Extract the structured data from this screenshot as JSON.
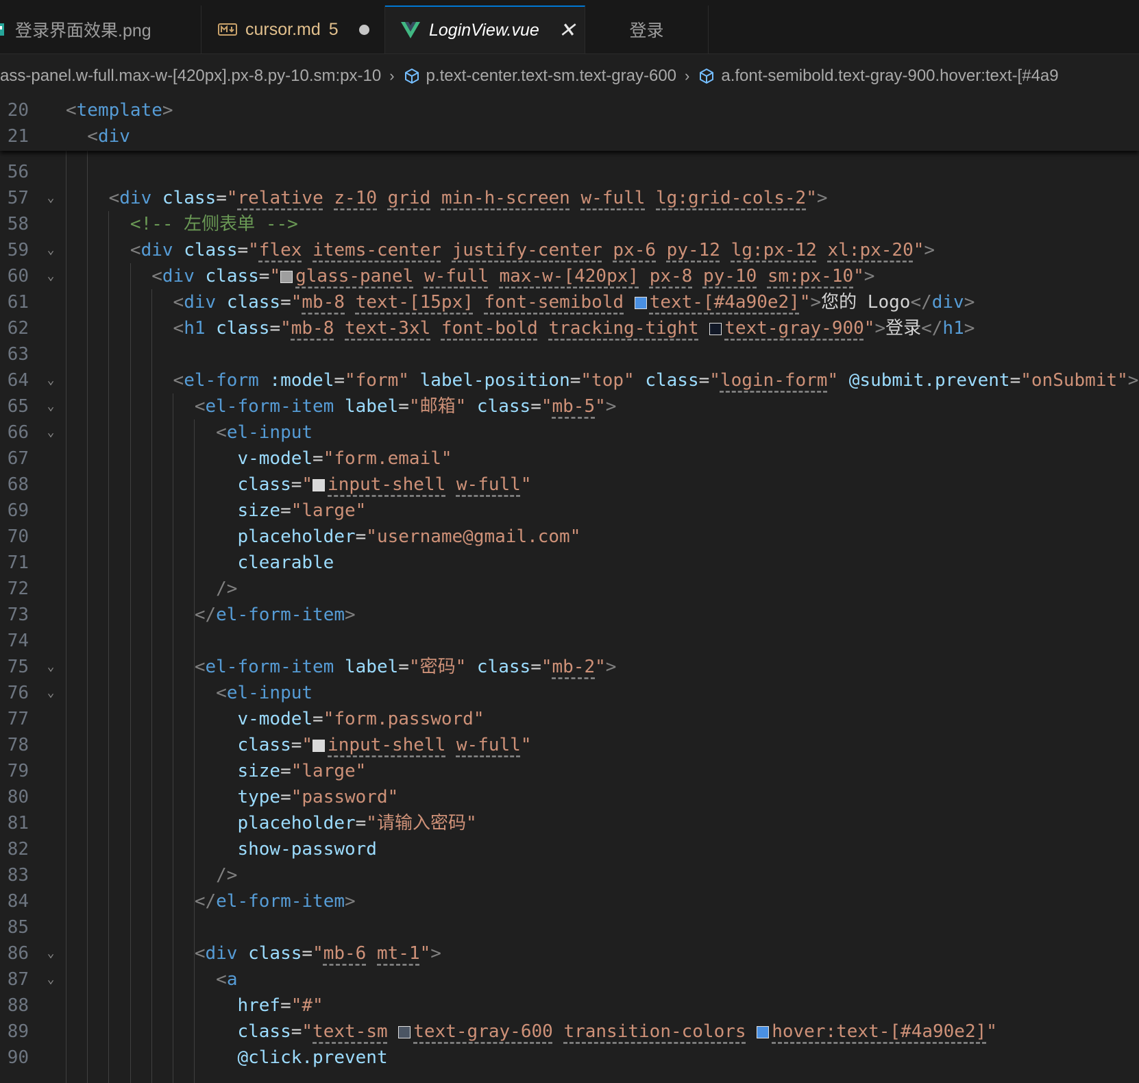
{
  "tabs": [
    {
      "label": "登录界面效果.png"
    },
    {
      "label": "cursor.md",
      "badge": "5"
    },
    {
      "label": "LoginView.vue"
    },
    {
      "label": "登录"
    }
  ],
  "breadcrumb": [
    "ass-panel.w-full.max-w-[420px].px-8.py-10.sm:px-10",
    "p.text-center.text-sm.text-gray-600",
    "a.font-semibold.text-gray-900.hover:text-[#4a9"
  ],
  "swatches": {
    "glass_panel": "#9e9e9e",
    "text_blue": "#4a90e2",
    "text_gray_900": "#111827",
    "input_shell": "#d9d9d9",
    "text_gray_600": "#4b5563"
  },
  "sticky_lines": [
    {
      "num": "20",
      "code": [
        {
          "c": "t",
          "v": "<"
        },
        {
          "c": "tg",
          "v": "template"
        },
        {
          "c": "t",
          "v": ">"
        }
      ]
    },
    {
      "num": "21",
      "code": [
        {
          "c": "t",
          "v": "  <"
        },
        {
          "c": "tg",
          "v": "div"
        }
      ]
    }
  ],
  "lines": [
    {
      "num": "56",
      "fold": false,
      "code": []
    },
    {
      "num": "57",
      "fold": true,
      "code": [
        {
          "c": "t",
          "v": "    <"
        },
        {
          "c": "tg",
          "v": "div"
        },
        {
          "c": "tx",
          "v": " "
        },
        {
          "c": "at",
          "v": "class"
        },
        {
          "c": "tx",
          "v": "="
        },
        {
          "c": "s",
          "v": "\""
        },
        {
          "c": "s cls",
          "v": "relative"
        },
        {
          "c": "s",
          "v": " "
        },
        {
          "c": "s cls",
          "v": "z-10"
        },
        {
          "c": "s",
          "v": " "
        },
        {
          "c": "s cls",
          "v": "grid"
        },
        {
          "c": "s",
          "v": " "
        },
        {
          "c": "s cls",
          "v": "min-h-screen"
        },
        {
          "c": "s",
          "v": " "
        },
        {
          "c": "s cls",
          "v": "w-full"
        },
        {
          "c": "s",
          "v": " "
        },
        {
          "c": "s cls",
          "v": "lg:grid-cols-2"
        },
        {
          "c": "s",
          "v": "\""
        },
        {
          "c": "t",
          "v": ">"
        }
      ]
    },
    {
      "num": "58",
      "fold": false,
      "code": [
        {
          "c": "cm",
          "v": "      <!-- 左侧表单 -->"
        }
      ]
    },
    {
      "num": "59",
      "fold": true,
      "code": [
        {
          "c": "t",
          "v": "      <"
        },
        {
          "c": "tg",
          "v": "div"
        },
        {
          "c": "tx",
          "v": " "
        },
        {
          "c": "at",
          "v": "class"
        },
        {
          "c": "tx",
          "v": "="
        },
        {
          "c": "s",
          "v": "\""
        },
        {
          "c": "s cls",
          "v": "flex"
        },
        {
          "c": "s",
          "v": " "
        },
        {
          "c": "s cls",
          "v": "items-center"
        },
        {
          "c": "s",
          "v": " "
        },
        {
          "c": "s cls",
          "v": "justify-center"
        },
        {
          "c": "s",
          "v": " "
        },
        {
          "c": "s cls",
          "v": "px-6"
        },
        {
          "c": "s",
          "v": " "
        },
        {
          "c": "s cls",
          "v": "py-12"
        },
        {
          "c": "s",
          "v": " "
        },
        {
          "c": "s cls",
          "v": "lg:px-12"
        },
        {
          "c": "s",
          "v": " "
        },
        {
          "c": "s cls",
          "v": "xl:px-20"
        },
        {
          "c": "s",
          "v": "\""
        },
        {
          "c": "t",
          "v": ">"
        }
      ]
    },
    {
      "num": "60",
      "fold": true,
      "code": [
        {
          "c": "t",
          "v": "        <"
        },
        {
          "c": "tg",
          "v": "div"
        },
        {
          "c": "tx",
          "v": " "
        },
        {
          "c": "at",
          "v": "class"
        },
        {
          "c": "tx",
          "v": "="
        },
        {
          "c": "s",
          "v": "\""
        },
        {
          "sw": "glass_panel"
        },
        {
          "c": "s cls",
          "v": "glass-panel"
        },
        {
          "c": "s",
          "v": " "
        },
        {
          "c": "s cls",
          "v": "w-full"
        },
        {
          "c": "s",
          "v": " "
        },
        {
          "c": "s cls",
          "v": "max-w-[420px]"
        },
        {
          "c": "s",
          "v": " "
        },
        {
          "c": "s cls",
          "v": "px-8"
        },
        {
          "c": "s",
          "v": " "
        },
        {
          "c": "s cls",
          "v": "py-10"
        },
        {
          "c": "s",
          "v": " "
        },
        {
          "c": "s cls",
          "v": "sm:px-10"
        },
        {
          "c": "s",
          "v": "\""
        },
        {
          "c": "t",
          "v": ">"
        }
      ]
    },
    {
      "num": "61",
      "fold": false,
      "code": [
        {
          "c": "t",
          "v": "          <"
        },
        {
          "c": "tg",
          "v": "div"
        },
        {
          "c": "tx",
          "v": " "
        },
        {
          "c": "at",
          "v": "class"
        },
        {
          "c": "tx",
          "v": "="
        },
        {
          "c": "s",
          "v": "\""
        },
        {
          "c": "s cls",
          "v": "mb-8"
        },
        {
          "c": "s",
          "v": " "
        },
        {
          "c": "s cls",
          "v": "text-[15px]"
        },
        {
          "c": "s",
          "v": " "
        },
        {
          "c": "s cls",
          "v": "font-semibold"
        },
        {
          "c": "s",
          "v": " "
        },
        {
          "sw": "text_blue"
        },
        {
          "c": "s cls",
          "v": "text-[#4a90e2]"
        },
        {
          "c": "s",
          "v": "\""
        },
        {
          "c": "t",
          "v": ">"
        },
        {
          "c": "tx",
          "v": "您的 Logo"
        },
        {
          "c": "t",
          "v": "</"
        },
        {
          "c": "tg",
          "v": "div"
        },
        {
          "c": "t",
          "v": ">"
        }
      ]
    },
    {
      "num": "62",
      "fold": false,
      "code": [
        {
          "c": "t",
          "v": "          <"
        },
        {
          "c": "tg",
          "v": "h1"
        },
        {
          "c": "tx",
          "v": " "
        },
        {
          "c": "at",
          "v": "class"
        },
        {
          "c": "tx",
          "v": "="
        },
        {
          "c": "s",
          "v": "\""
        },
        {
          "c": "s cls",
          "v": "mb-8"
        },
        {
          "c": "s",
          "v": " "
        },
        {
          "c": "s cls",
          "v": "text-3xl"
        },
        {
          "c": "s",
          "v": " "
        },
        {
          "c": "s cls",
          "v": "font-bold"
        },
        {
          "c": "s",
          "v": " "
        },
        {
          "c": "s cls",
          "v": "tracking-tight"
        },
        {
          "c": "s",
          "v": " "
        },
        {
          "sw": "text_gray_900"
        },
        {
          "c": "s cls",
          "v": "text-gray-900"
        },
        {
          "c": "s",
          "v": "\""
        },
        {
          "c": "t",
          "v": ">"
        },
        {
          "c": "tx",
          "v": "登录"
        },
        {
          "c": "t",
          "v": "</"
        },
        {
          "c": "tg",
          "v": "h1"
        },
        {
          "c": "t",
          "v": ">"
        }
      ]
    },
    {
      "num": "63",
      "fold": false,
      "code": []
    },
    {
      "num": "64",
      "fold": true,
      "code": [
        {
          "c": "t",
          "v": "          <"
        },
        {
          "c": "tg",
          "v": "el-form"
        },
        {
          "c": "tx",
          "v": " "
        },
        {
          "c": "at",
          "v": ":model"
        },
        {
          "c": "tx",
          "v": "="
        },
        {
          "c": "s",
          "v": "\"form\""
        },
        {
          "c": "tx",
          "v": " "
        },
        {
          "c": "at",
          "v": "label-position"
        },
        {
          "c": "tx",
          "v": "="
        },
        {
          "c": "s",
          "v": "\"top\""
        },
        {
          "c": "tx",
          "v": " "
        },
        {
          "c": "at",
          "v": "class"
        },
        {
          "c": "tx",
          "v": "="
        },
        {
          "c": "s",
          "v": "\""
        },
        {
          "c": "s cls",
          "v": "login-form"
        },
        {
          "c": "s",
          "v": "\""
        },
        {
          "c": "tx",
          "v": " "
        },
        {
          "c": "at",
          "v": "@submit.prevent"
        },
        {
          "c": "tx",
          "v": "="
        },
        {
          "c": "s",
          "v": "\"onSubmit\""
        },
        {
          "c": "t",
          "v": ">"
        }
      ]
    },
    {
      "num": "65",
      "fold": true,
      "code": [
        {
          "c": "t",
          "v": "            <"
        },
        {
          "c": "tg",
          "v": "el-form-item"
        },
        {
          "c": "tx",
          "v": " "
        },
        {
          "c": "at",
          "v": "label"
        },
        {
          "c": "tx",
          "v": "="
        },
        {
          "c": "s",
          "v": "\"邮箱\""
        },
        {
          "c": "tx",
          "v": " "
        },
        {
          "c": "at",
          "v": "class"
        },
        {
          "c": "tx",
          "v": "="
        },
        {
          "c": "s",
          "v": "\""
        },
        {
          "c": "s cls",
          "v": "mb-5"
        },
        {
          "c": "s",
          "v": "\""
        },
        {
          "c": "t",
          "v": ">"
        }
      ]
    },
    {
      "num": "66",
      "fold": true,
      "code": [
        {
          "c": "t",
          "v": "              <"
        },
        {
          "c": "tg",
          "v": "el-input"
        }
      ]
    },
    {
      "num": "67",
      "fold": false,
      "code": [
        {
          "c": "tx",
          "v": "                "
        },
        {
          "c": "at",
          "v": "v-model"
        },
        {
          "c": "tx",
          "v": "="
        },
        {
          "c": "s",
          "v": "\"form.email\""
        }
      ]
    },
    {
      "num": "68",
      "fold": false,
      "code": [
        {
          "c": "tx",
          "v": "                "
        },
        {
          "c": "at",
          "v": "class"
        },
        {
          "c": "tx",
          "v": "="
        },
        {
          "c": "s",
          "v": "\""
        },
        {
          "sw": "input_shell"
        },
        {
          "c": "s cls",
          "v": "input-shell"
        },
        {
          "c": "s",
          "v": " "
        },
        {
          "c": "s cls",
          "v": "w-full"
        },
        {
          "c": "s",
          "v": "\""
        }
      ]
    },
    {
      "num": "69",
      "fold": false,
      "code": [
        {
          "c": "tx",
          "v": "                "
        },
        {
          "c": "at",
          "v": "size"
        },
        {
          "c": "tx",
          "v": "="
        },
        {
          "c": "s",
          "v": "\"large\""
        }
      ]
    },
    {
      "num": "70",
      "fold": false,
      "code": [
        {
          "c": "tx",
          "v": "                "
        },
        {
          "c": "at",
          "v": "placeholder"
        },
        {
          "c": "tx",
          "v": "="
        },
        {
          "c": "s",
          "v": "\"username@gmail.com\""
        }
      ]
    },
    {
      "num": "71",
      "fold": false,
      "code": [
        {
          "c": "tx",
          "v": "                "
        },
        {
          "c": "at",
          "v": "clearable"
        }
      ]
    },
    {
      "num": "72",
      "fold": false,
      "code": [
        {
          "c": "t",
          "v": "              />"
        }
      ]
    },
    {
      "num": "73",
      "fold": false,
      "code": [
        {
          "c": "t",
          "v": "            </"
        },
        {
          "c": "tg",
          "v": "el-form-item"
        },
        {
          "c": "t",
          "v": ">"
        }
      ]
    },
    {
      "num": "74",
      "fold": false,
      "code": []
    },
    {
      "num": "75",
      "fold": true,
      "code": [
        {
          "c": "t",
          "v": "            <"
        },
        {
          "c": "tg",
          "v": "el-form-item"
        },
        {
          "c": "tx",
          "v": " "
        },
        {
          "c": "at",
          "v": "label"
        },
        {
          "c": "tx",
          "v": "="
        },
        {
          "c": "s",
          "v": "\"密码\""
        },
        {
          "c": "tx",
          "v": " "
        },
        {
          "c": "at",
          "v": "class"
        },
        {
          "c": "tx",
          "v": "="
        },
        {
          "c": "s",
          "v": "\""
        },
        {
          "c": "s cls",
          "v": "mb-2"
        },
        {
          "c": "s",
          "v": "\""
        },
        {
          "c": "t",
          "v": ">"
        }
      ]
    },
    {
      "num": "76",
      "fold": true,
      "code": [
        {
          "c": "t",
          "v": "              <"
        },
        {
          "c": "tg",
          "v": "el-input"
        }
      ]
    },
    {
      "num": "77",
      "fold": false,
      "code": [
        {
          "c": "tx",
          "v": "                "
        },
        {
          "c": "at",
          "v": "v-model"
        },
        {
          "c": "tx",
          "v": "="
        },
        {
          "c": "s",
          "v": "\"form.password\""
        }
      ]
    },
    {
      "num": "78",
      "fold": false,
      "code": [
        {
          "c": "tx",
          "v": "                "
        },
        {
          "c": "at",
          "v": "class"
        },
        {
          "c": "tx",
          "v": "="
        },
        {
          "c": "s",
          "v": "\""
        },
        {
          "sw": "input_shell"
        },
        {
          "c": "s cls",
          "v": "input-shell"
        },
        {
          "c": "s",
          "v": " "
        },
        {
          "c": "s cls",
          "v": "w-full"
        },
        {
          "c": "s",
          "v": "\""
        }
      ]
    },
    {
      "num": "79",
      "fold": false,
      "code": [
        {
          "c": "tx",
          "v": "                "
        },
        {
          "c": "at",
          "v": "size"
        },
        {
          "c": "tx",
          "v": "="
        },
        {
          "c": "s",
          "v": "\"large\""
        }
      ]
    },
    {
      "num": "80",
      "fold": false,
      "code": [
        {
          "c": "tx",
          "v": "                "
        },
        {
          "c": "at",
          "v": "type"
        },
        {
          "c": "tx",
          "v": "="
        },
        {
          "c": "s",
          "v": "\"password\""
        }
      ]
    },
    {
      "num": "81",
      "fold": false,
      "code": [
        {
          "c": "tx",
          "v": "                "
        },
        {
          "c": "at",
          "v": "placeholder"
        },
        {
          "c": "tx",
          "v": "="
        },
        {
          "c": "s",
          "v": "\"请输入密码\""
        }
      ]
    },
    {
      "num": "82",
      "fold": false,
      "code": [
        {
          "c": "tx",
          "v": "                "
        },
        {
          "c": "at",
          "v": "show-password"
        }
      ]
    },
    {
      "num": "83",
      "fold": false,
      "code": [
        {
          "c": "t",
          "v": "              />"
        }
      ]
    },
    {
      "num": "84",
      "fold": false,
      "code": [
        {
          "c": "t",
          "v": "            </"
        },
        {
          "c": "tg",
          "v": "el-form-item"
        },
        {
          "c": "t",
          "v": ">"
        }
      ]
    },
    {
      "num": "85",
      "fold": false,
      "code": []
    },
    {
      "num": "86",
      "fold": true,
      "code": [
        {
          "c": "t",
          "v": "            <"
        },
        {
          "c": "tg",
          "v": "div"
        },
        {
          "c": "tx",
          "v": " "
        },
        {
          "c": "at",
          "v": "class"
        },
        {
          "c": "tx",
          "v": "="
        },
        {
          "c": "s",
          "v": "\""
        },
        {
          "c": "s cls",
          "v": "mb-6"
        },
        {
          "c": "s",
          "v": " "
        },
        {
          "c": "s cls",
          "v": "mt-1"
        },
        {
          "c": "s",
          "v": "\""
        },
        {
          "c": "t",
          "v": ">"
        }
      ]
    },
    {
      "num": "87",
      "fold": true,
      "code": [
        {
          "c": "t",
          "v": "              <"
        },
        {
          "c": "tg",
          "v": "a"
        }
      ]
    },
    {
      "num": "88",
      "fold": false,
      "code": [
        {
          "c": "tx",
          "v": "                "
        },
        {
          "c": "at",
          "v": "href"
        },
        {
          "c": "tx",
          "v": "="
        },
        {
          "c": "s",
          "v": "\"#\""
        }
      ]
    },
    {
      "num": "89",
      "fold": false,
      "code": [
        {
          "c": "tx",
          "v": "                "
        },
        {
          "c": "at",
          "v": "class"
        },
        {
          "c": "tx",
          "v": "="
        },
        {
          "c": "s",
          "v": "\""
        },
        {
          "c": "s cls",
          "v": "text-sm"
        },
        {
          "c": "s",
          "v": " "
        },
        {
          "sw": "text_gray_600"
        },
        {
          "c": "s cls",
          "v": "text-gray-600"
        },
        {
          "c": "s",
          "v": " "
        },
        {
          "c": "s cls",
          "v": "transition-colors"
        },
        {
          "c": "s",
          "v": " "
        },
        {
          "sw": "text_blue"
        },
        {
          "c": "s cls",
          "v": "hover:text-[#4a90e2]"
        },
        {
          "c": "s",
          "v": "\""
        }
      ]
    },
    {
      "num": "90",
      "fold": false,
      "code": [
        {
          "c": "tx",
          "v": "                "
        },
        {
          "c": "at",
          "v": "@click.prevent"
        }
      ]
    }
  ]
}
